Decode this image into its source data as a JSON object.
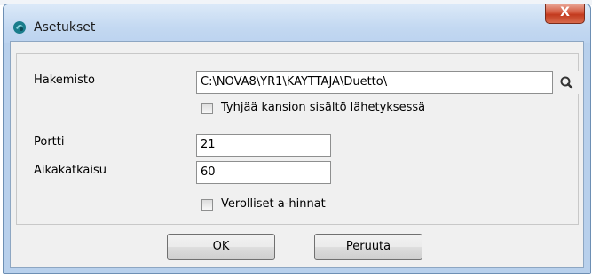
{
  "window": {
    "title": "Asetukset",
    "close_label": "X"
  },
  "form": {
    "directory": {
      "label": "Hakemisto",
      "value": "C:\\NOVA8\\YR1\\KAYTTAJA\\Duetto\\"
    },
    "clear_folder": {
      "label": "Tyhjää kansion sisältö lähetyksessä",
      "checked": false
    },
    "port": {
      "label": "Portti",
      "value": "21"
    },
    "timeout": {
      "label": "Aikakatkaisu",
      "value": "60"
    },
    "vat_prices": {
      "label": "Verolliset a-hinnat",
      "checked": false
    }
  },
  "buttons": {
    "ok": "OK",
    "cancel": "Peruuta"
  },
  "icons": {
    "app": "app-icon",
    "search": "search-icon",
    "close": "close-icon"
  },
  "colors": {
    "title_bar": "#c3d8f1",
    "close_button": "#c23a1e",
    "client_bg": "#f0f0f0"
  }
}
